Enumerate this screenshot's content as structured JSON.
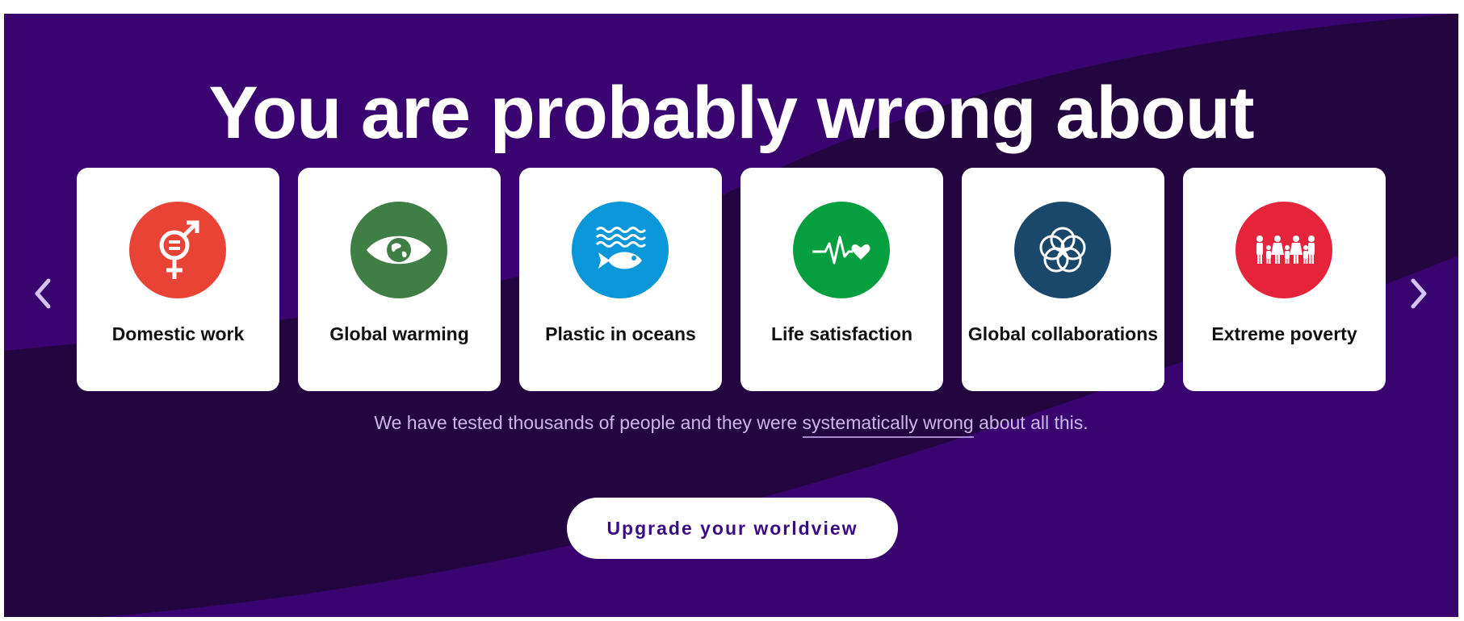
{
  "hero": {
    "headline": "You are probably wrong about",
    "tagline_before": "We have tested thousands of people and they were ",
    "tagline_link": "systematically wrong",
    "tagline_after": " about all this.",
    "cta_label": "Upgrade your worldview"
  },
  "carousel": {
    "prev_icon": "chevron-left-icon",
    "next_icon": "chevron-right-icon",
    "cards": [
      {
        "label": "Domestic work",
        "icon": "gender-equality-icon",
        "color": "#e94336"
      },
      {
        "label": "Global warming",
        "icon": "climate-eye-icon",
        "color": "#3f7e45"
      },
      {
        "label": "Plastic in oceans",
        "icon": "fish-waves-icon",
        "color": "#0a97d9"
      },
      {
        "label": "Life satisfaction",
        "icon": "heartbeat-icon",
        "color": "#069f3f"
      },
      {
        "label": "Global collaborations",
        "icon": "interlocking-rings-icon",
        "color": "#19486a"
      },
      {
        "label": "Extreme poverty",
        "icon": "family-icon",
        "color": "#e5243b"
      }
    ]
  },
  "colors": {
    "background_light": "#3a0470",
    "background_dark": "#23053f",
    "cta_text": "#3a0a84"
  }
}
